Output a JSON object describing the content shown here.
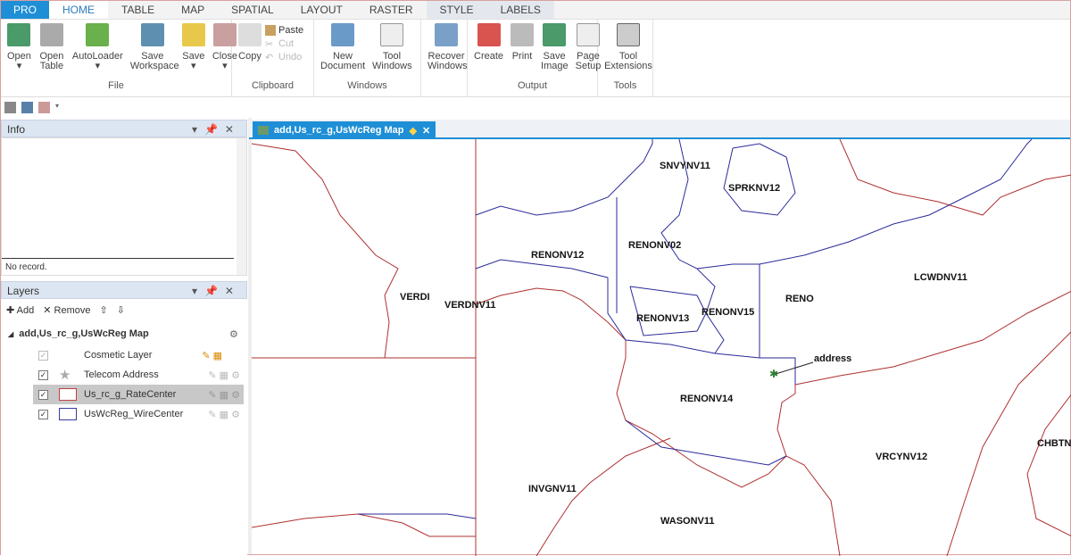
{
  "ribbon_tabs": [
    "PRO",
    "HOME",
    "TABLE",
    "MAP",
    "SPATIAL",
    "LAYOUT",
    "RASTER",
    "STYLE",
    "LABELS"
  ],
  "ribbon": {
    "file": {
      "label": "File",
      "buttons": [
        "Open",
        "Open Table",
        "AutoLoader",
        "Save Workspace",
        "Save",
        "Close"
      ]
    },
    "clipboard": {
      "label": "Clipboard",
      "copy": "Copy",
      "paste": "Paste",
      "cut": "Cut",
      "undo": "Undo"
    },
    "windows": {
      "label": "Windows",
      "buttons": [
        "New Document",
        "Tool Windows",
        "Recover Windows"
      ]
    },
    "output": {
      "label": "Output",
      "buttons": [
        "Create",
        "Print",
        "Save Image",
        "Page Setup"
      ]
    },
    "tools": {
      "label": "Tools",
      "buttons": [
        "Tool Extensions"
      ]
    }
  },
  "info": {
    "title": "Info",
    "status": "No record."
  },
  "layers": {
    "title": "Layers",
    "add": "Add",
    "remove": "Remove",
    "map_name": "add,Us_rc_g,UsWcReg Map",
    "items": [
      {
        "name": "Cosmetic Layer",
        "checked": true
      },
      {
        "name": "Telecom Address",
        "checked": true
      },
      {
        "name": "Us_rc_g_RateCenter",
        "checked": true,
        "selected": true
      },
      {
        "name": "UsWcReg_WireCenter",
        "checked": true
      }
    ]
  },
  "map_tab": {
    "title": "add,Us_rc_g,UsWcReg Map"
  },
  "map": {
    "labels": [
      "SNVYNV11",
      "SPRKNV12",
      "RENONV02",
      "RENONV12",
      "LCWDNV11",
      "RENO",
      "VERDI",
      "VERDNV11",
      "RENONV13",
      "RENONV15",
      "address",
      "RENONV14",
      "CHBTN",
      "VRCYNV12",
      "INVGNV11",
      "WASONV11"
    ],
    "colors": {
      "rate_center": "#b03030",
      "wire_center": "#2a2a9a",
      "address": "#2e7d32"
    }
  }
}
